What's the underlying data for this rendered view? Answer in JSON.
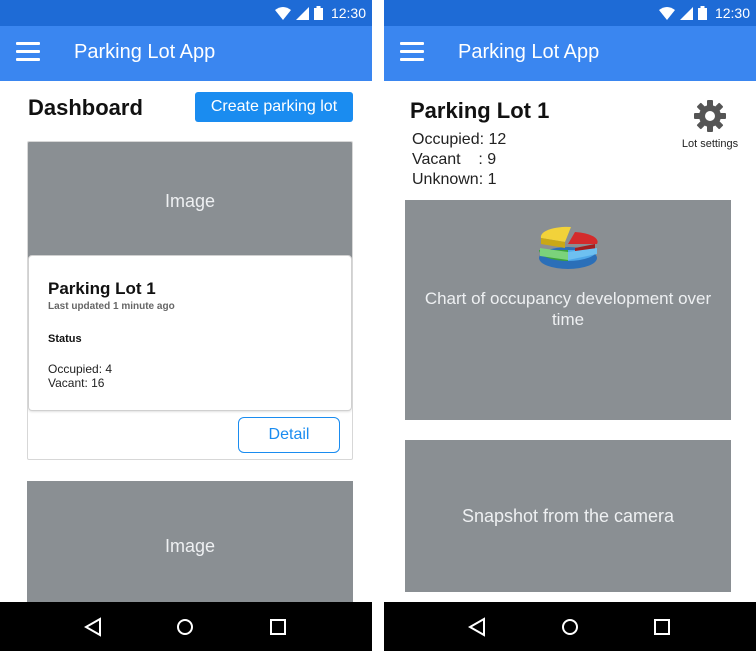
{
  "status_bar": {
    "time": "12:30"
  },
  "app": {
    "title": "Parking Lot App"
  },
  "dashboard": {
    "title": "Dashboard",
    "create_button": "Create parking lot",
    "cards": [
      {
        "image_label": "Image",
        "lot_name": "Parking Lot 1",
        "updated": "Last updated 1 minute ago",
        "status_heading": "Status",
        "occupied": "Occupied: 4",
        "vacant": "Vacant: 16",
        "detail_button": "Detail"
      },
      {
        "image_label": "Image"
      }
    ]
  },
  "detail": {
    "lot_name": "Parking Lot 1",
    "occupied": "Occupied: 12",
    "vacant": "Vacant    : 9",
    "unknown": "Unknown: 1",
    "settings_label": "Lot settings",
    "chart_caption": "Chart of occupancy development over time",
    "snapshot_caption": "Snapshot from the camera"
  },
  "icons": {
    "menu": "hamburger-menu-icon",
    "settings": "gear-icon",
    "chart": "pie-chart-icon",
    "back": "back-triangle-icon",
    "home": "home-circle-icon",
    "recents": "recents-square-icon"
  },
  "colors": {
    "status_bar": "#1e6bd6",
    "app_bar": "#3a86f0",
    "primary_button": "#1a8cf0",
    "placeholder": "#8a8f93"
  }
}
